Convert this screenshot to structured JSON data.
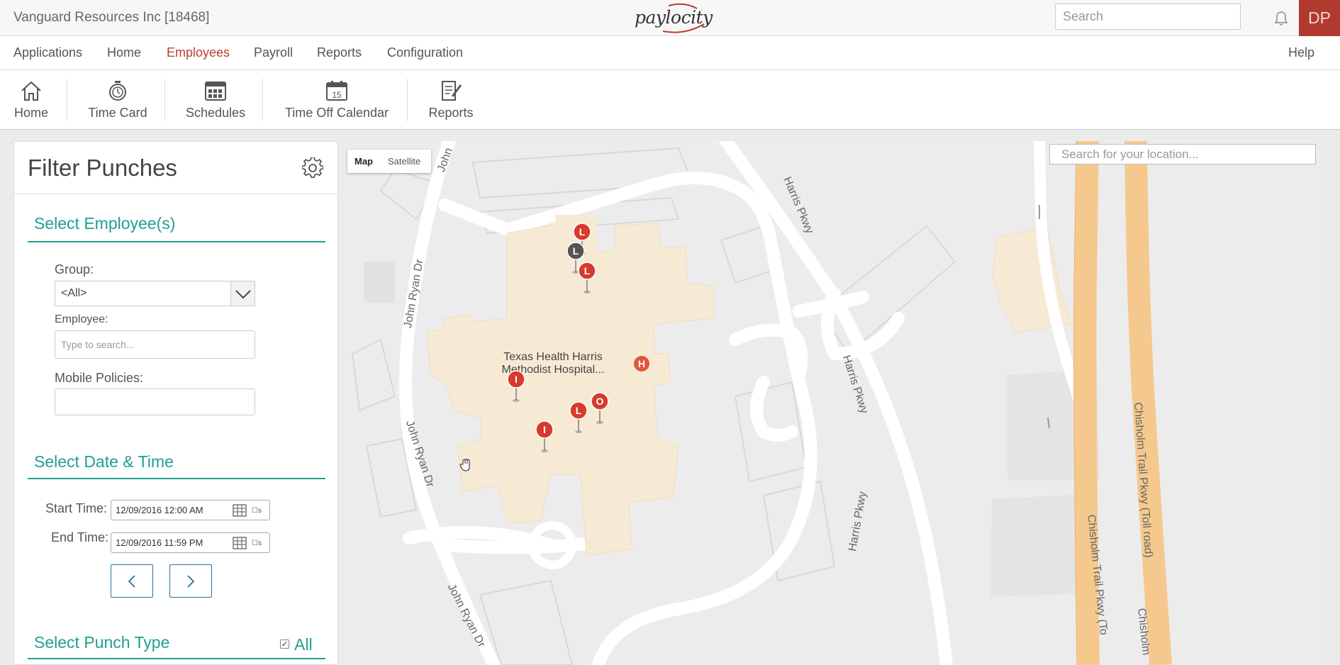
{
  "header": {
    "company": "Vanguard Resources Inc [18468]",
    "logo_text": "paylocity",
    "search_placeholder": "Search",
    "user_initials": "DP",
    "brand_color": "#b03a2e"
  },
  "main_nav": {
    "items": [
      "Applications",
      "Home",
      "Employees",
      "Payroll",
      "Reports",
      "Configuration"
    ],
    "active": "Employees",
    "help": "Help"
  },
  "toolbar": {
    "items": [
      {
        "label": "Home",
        "icon": "home-icon"
      },
      {
        "label": "Time Card",
        "icon": "stopwatch-icon"
      },
      {
        "label": "Schedules",
        "icon": "schedule-grid-icon"
      },
      {
        "label": "Time Off Calendar",
        "icon": "calendar-icon"
      },
      {
        "label": "Reports",
        "icon": "report-icon"
      }
    ],
    "calendar_day": "15"
  },
  "filter": {
    "title": "Filter Punches",
    "accent_color": "#21a08e",
    "employees_section": "Select Employee(s)",
    "group_label": "Group:",
    "group_value": "<All>",
    "employee_label": "Employee:",
    "employee_placeholder": "Type to search...",
    "mobile_policies_label": "Mobile Policies:",
    "mobile_policies_value": "",
    "datetime_section": "Select Date & Time",
    "start_label": "Start Time:",
    "start_value": "12/09/2016 12:00 AM",
    "end_label": "End Time:",
    "end_value": "12/09/2016 11:59 PM",
    "punch_type_section": "Select Punch Type",
    "punch_type_all": "All",
    "punch_type_all_checked": true
  },
  "map": {
    "toggle": [
      "Map",
      "Satellite"
    ],
    "toggle_active": "Map",
    "search_placeholder": "Search for your location...",
    "streets": [
      "John",
      "John Ryan Dr",
      "John Ryan Dr",
      "John Ryan Dr",
      "Harris Pkwy",
      "Harris Pkwy",
      "Harris Pkwy",
      "Chisholm Trail Pkwy (Toll road)",
      "Chisholm Trail Pkwy (To",
      "Chisholm"
    ],
    "poi_name": "Texas Health Harris Methodist Hospital...",
    "poi_marker": "H",
    "markers": [
      "L",
      "L",
      "L",
      "I",
      "L",
      "O",
      "I"
    ]
  }
}
